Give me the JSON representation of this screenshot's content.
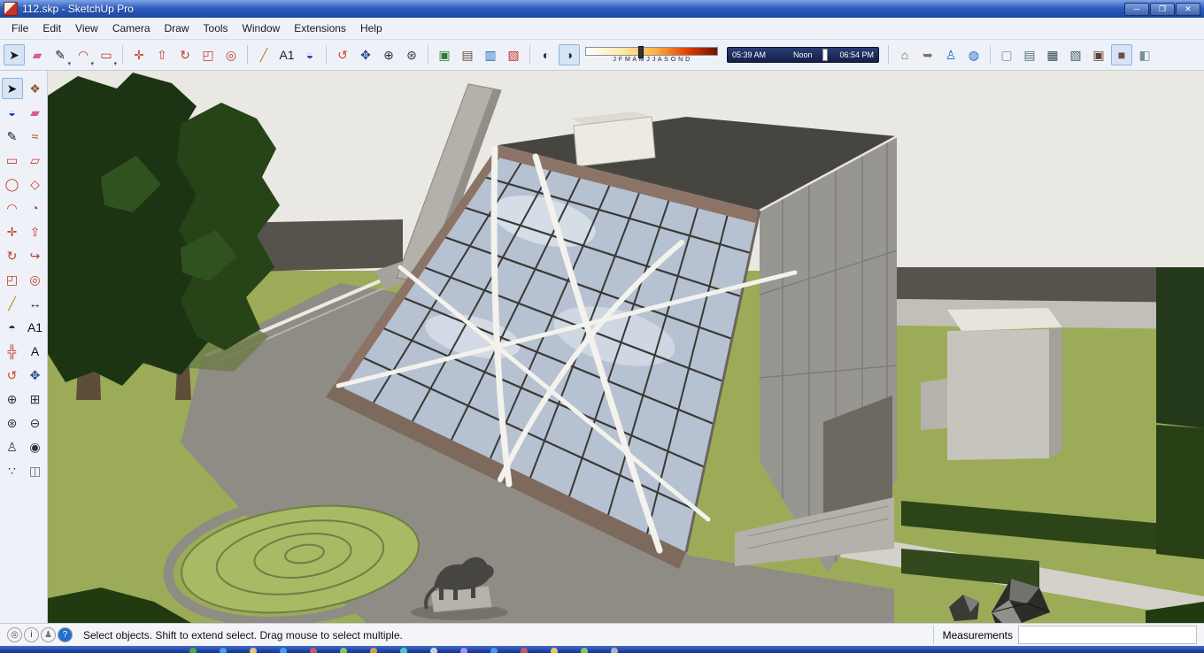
{
  "window": {
    "title": "112.skp - SketchUp Pro"
  },
  "window_controls": {
    "minimize": "─",
    "maximize": "❐",
    "close": "✕"
  },
  "menu": {
    "items": [
      {
        "name": "menu-file",
        "label": "File"
      },
      {
        "name": "menu-edit",
        "label": "Edit"
      },
      {
        "name": "menu-view",
        "label": "View"
      },
      {
        "name": "menu-camera",
        "label": "Camera"
      },
      {
        "name": "menu-draw",
        "label": "Draw"
      },
      {
        "name": "menu-tools",
        "label": "Tools"
      },
      {
        "name": "menu-window",
        "label": "Window"
      },
      {
        "name": "menu-extensions",
        "label": "Extensions"
      },
      {
        "name": "menu-help",
        "label": "Help"
      }
    ]
  },
  "toolbar": {
    "groups": [
      {
        "items": [
          {
            "name": "select-tool-icon",
            "glyph": "➤",
            "color": "#1a1a1a",
            "active": true
          },
          {
            "name": "eraser-tool-icon",
            "glyph": "▰",
            "color": "#d4608a"
          },
          {
            "name": "line-tool-icon",
            "glyph": "✎",
            "color": "#1a1a1a",
            "caret": true
          },
          {
            "name": "arc-tool-icon",
            "glyph": "◠",
            "color": "#c0392b",
            "caret": true
          },
          {
            "name": "rectangle-tool-icon",
            "glyph": "▭",
            "color": "#c0392b",
            "caret": true
          }
        ]
      },
      {
        "items": [
          {
            "name": "move-tool-icon",
            "glyph": "✛",
            "color": "#c0392b"
          },
          {
            "name": "push-pull-tool-icon",
            "glyph": "⇧",
            "color": "#c0392b"
          },
          {
            "name": "rotate-tool-icon",
            "glyph": "↻",
            "color": "#c0392b"
          },
          {
            "name": "scale-tool-icon",
            "glyph": "◰",
            "color": "#c0392b"
          },
          {
            "name": "offset-tool-icon",
            "glyph": "◎",
            "color": "#c0392b"
          }
        ]
      },
      {
        "items": [
          {
            "name": "tape-measure-tool-icon",
            "glyph": "╱",
            "color": "#b8860b"
          },
          {
            "name": "text-tool-icon",
            "glyph": "A1",
            "color": "#1a1a1a"
          },
          {
            "name": "paint-bucket-tool-icon",
            "glyph": "◒",
            "color": "#2244cc"
          }
        ]
      },
      {
        "items": [
          {
            "name": "orbit-tool-icon",
            "glyph": "↺",
            "color": "#cc4422"
          },
          {
            "name": "pan-tool-icon",
            "glyph": "✥",
            "color": "#224488"
          },
          {
            "name": "zoom-tool-icon",
            "glyph": "⊕",
            "color": "#333333"
          },
          {
            "name": "zoom-extents-tool-icon",
            "glyph": "⊛",
            "color": "#333333"
          }
        ]
      },
      {
        "items": [
          {
            "name": "add-location-icon",
            "glyph": "▣",
            "color": "#2e7d32"
          },
          {
            "name": "toggle-terrain-icon",
            "glyph": "▤",
            "color": "#6d4c41"
          },
          {
            "name": "photo-textures-icon",
            "glyph": "▥",
            "color": "#1565c0"
          },
          {
            "name": "match-photo-icon",
            "glyph": "▧",
            "color": "#c62828"
          }
        ]
      },
      {
        "items": [
          {
            "name": "shadow-settings-icon",
            "glyph": "◐",
            "color": "#1b2a4a"
          },
          {
            "name": "toggle-shadows-icon",
            "glyph": "◑",
            "color": "#1b2a4a",
            "active": true
          }
        ]
      },
      {
        "items": [
          {
            "name": "3d-warehouse-icon",
            "glyph": "⌂",
            "color": "#2e7d32"
          },
          {
            "name": "share-model-icon",
            "glyph": "➥",
            "color": "#8d6e63"
          },
          {
            "name": "scale-figure-icon",
            "glyph": "♙",
            "color": "#1565c0"
          },
          {
            "name": "geolocation-globe-icon",
            "glyph": "◍",
            "color": "#1565c0"
          }
        ]
      },
      {
        "items": [
          {
            "name": "style-xray-icon",
            "glyph": "▢",
            "color": "#78909c"
          },
          {
            "name": "style-back-edges-icon",
            "glyph": "▤",
            "color": "#546e7a"
          },
          {
            "name": "style-wireframe-icon",
            "glyph": "▦",
            "color": "#37474f"
          },
          {
            "name": "style-hidden-line-icon",
            "glyph": "▧",
            "color": "#455a64"
          },
          {
            "name": "style-shaded-icon",
            "glyph": "▣",
            "color": "#5d4037"
          },
          {
            "name": "style-shaded-textures-icon",
            "glyph": "■",
            "color": "#6d4c41",
            "active": true
          },
          {
            "name": "style-monochrome-icon",
            "glyph": "◧",
            "color": "#78909c"
          }
        ]
      }
    ]
  },
  "shadows": {
    "months": "J F M A M J J A S O N D",
    "time_start": "05:39 AM",
    "time_noon": "Noon",
    "time_end": "06:54 PM",
    "date_slider_pos": "40%",
    "time_slider_pos": "63%"
  },
  "left_palette": {
    "items": [
      {
        "name": "select-tool-icon",
        "glyph": "➤",
        "color": "#111111",
        "active": true
      },
      {
        "name": "make-component-icon",
        "glyph": "❖",
        "color": "#8a5a2a"
      },
      {
        "name": "paint-bucket-tool-icon",
        "glyph": "◒",
        "color": "#2244cc"
      },
      {
        "name": "eraser-tool-icon",
        "glyph": "▰",
        "color": "#d4608a"
      },
      {
        "name": "line-tool-icon",
        "glyph": "✎",
        "color": "#111111"
      },
      {
        "name": "freehand-tool-icon",
        "glyph": "≈",
        "color": "#c0392b"
      },
      {
        "name": "rectangle-tool-icon",
        "glyph": "▭",
        "color": "#c0392b"
      },
      {
        "name": "rotated-rectangle-tool-icon",
        "glyph": "▱",
        "color": "#c0392b"
      },
      {
        "name": "circle-tool-icon",
        "glyph": "◯",
        "color": "#c0392b"
      },
      {
        "name": "polygon-tool-icon",
        "glyph": "◇",
        "color": "#c0392b"
      },
      {
        "name": "arc-tool-icon",
        "glyph": "◠",
        "color": "#c0392b"
      },
      {
        "name": "pie-tool-icon",
        "glyph": "◔",
        "color": "#c0392b"
      },
      {
        "name": "move-tool-icon",
        "glyph": "✛",
        "color": "#c0392b"
      },
      {
        "name": "push-pull-tool-icon",
        "glyph": "⇧",
        "color": "#c0392b"
      },
      {
        "name": "rotate-tool-icon",
        "glyph": "↻",
        "color": "#c0392b"
      },
      {
        "name": "follow-me-tool-icon",
        "glyph": "↪",
        "color": "#c0392b"
      },
      {
        "name": "scale-tool-icon",
        "glyph": "◰",
        "color": "#c0392b"
      },
      {
        "name": "offset-tool-icon",
        "glyph": "◎",
        "color": "#c0392b"
      },
      {
        "name": "tape-measure-tool-icon",
        "glyph": "╱",
        "color": "#b8860b"
      },
      {
        "name": "dimension-tool-icon",
        "glyph": "↔",
        "color": "#333333"
      },
      {
        "name": "protractor-tool-icon",
        "glyph": "◓",
        "color": "#333333"
      },
      {
        "name": "text-tool-icon",
        "glyph": "A1",
        "color": "#111111"
      },
      {
        "name": "axes-tool-icon",
        "glyph": "╬",
        "color": "#cc3333"
      },
      {
        "name": "3d-text-tool-icon",
        "glyph": "A",
        "color": "#111111"
      },
      {
        "name": "orbit-tool-icon",
        "glyph": "↺",
        "color": "#cc4422"
      },
      {
        "name": "pan-tool-icon",
        "glyph": "✥",
        "color": "#224488"
      },
      {
        "name": "zoom-tool-icon",
        "glyph": "⊕",
        "color": "#333333"
      },
      {
        "name": "zoom-window-tool-icon",
        "glyph": "⊞",
        "color": "#333333"
      },
      {
        "name": "zoom-extents-tool-icon",
        "glyph": "⊛",
        "color": "#333333"
      },
      {
        "name": "zoom-previous-tool-icon",
        "glyph": "⊖",
        "color": "#333333"
      },
      {
        "name": "position-camera-tool-icon",
        "glyph": "♙",
        "color": "#333333"
      },
      {
        "name": "look-around-tool-icon",
        "glyph": "◉",
        "color": "#333333"
      },
      {
        "name": "walk-tool-icon",
        "glyph": "∵",
        "color": "#333333"
      },
      {
        "name": "section-plane-tool-icon",
        "glyph": "◫",
        "color": "#666666"
      }
    ]
  },
  "statusbar": {
    "icons": [
      {
        "name": "geolocation-status-icon",
        "glyph": "◎",
        "color": "#555555",
        "bg": "#f5f5f5"
      },
      {
        "name": "credits-status-icon",
        "glyph": "i",
        "color": "#333333",
        "bg": "#f5f5f5"
      },
      {
        "name": "signin-status-icon",
        "glyph": "♟",
        "color": "#777777",
        "bg": "#f5f5f5"
      },
      {
        "name": "help-status-icon",
        "glyph": "?",
        "color": "#ffffff",
        "bg": "#1f6fd0"
      }
    ],
    "hint": "Select objects. Shift to extend select. Drag mouse to select multiple.",
    "measurements_label": "Measurements",
    "measurements_value": ""
  },
  "taskbar": {
    "icons": [
      {
        "name": "start-button",
        "bg": "#57b33e"
      },
      {
        "name": "taskbar-app-icon",
        "bg": "#4aa3ff"
      },
      {
        "name": "taskbar-app-icon",
        "bg": "#ffd36b"
      },
      {
        "name": "taskbar-app-icon",
        "bg": "#4aa3ff"
      },
      {
        "name": "taskbar-app-icon",
        "bg": "#d95b5b"
      },
      {
        "name": "taskbar-app-icon",
        "bg": "#9bd05a"
      },
      {
        "name": "taskbar-app-icon",
        "bg": "#f0a43c"
      },
      {
        "name": "taskbar-app-icon",
        "bg": "#5ad0c8"
      },
      {
        "name": "taskbar-app-icon",
        "bg": "#e0e0e0"
      },
      {
        "name": "taskbar-app-icon",
        "bg": "#b49aff"
      },
      {
        "name": "taskbar-app-icon",
        "bg": "#4aa3ff"
      },
      {
        "name": "taskbar-app-icon",
        "bg": "#d95b5b"
      },
      {
        "name": "taskbar-app-icon",
        "bg": "#ffd36b"
      },
      {
        "name": "taskbar-app-icon",
        "bg": "#9bd05a"
      },
      {
        "name": "taskbar-app-icon",
        "bg": "#c0c0c0"
      }
    ]
  },
  "viewport": {
    "palette": {
      "sky": "#e9e8e3",
      "lawn": "#9cab58",
      "wall": "#55534c",
      "plaza": "#8e8c84",
      "glass": "#b6c1d2",
      "concrete": "#989690",
      "mullion_band": "#8b7466",
      "tubes": "#f3f2ec",
      "tree": "#1d3413"
    }
  }
}
